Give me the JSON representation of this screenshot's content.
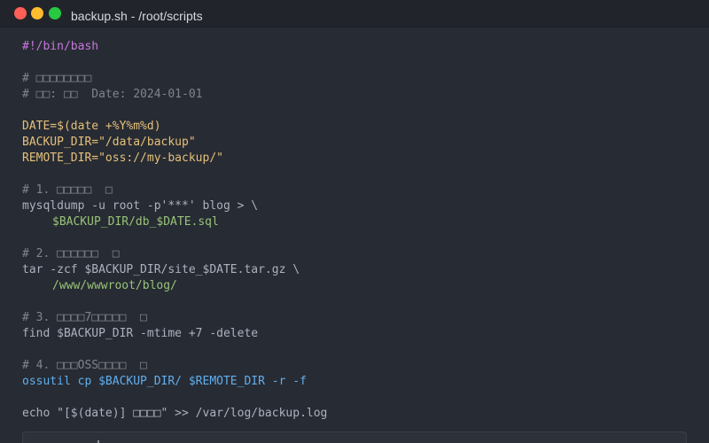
{
  "window": {
    "title": "backup.sh - /root/scripts",
    "controls": {
      "close_color": "#ff5f57",
      "minimize_color": "#febc2e",
      "maximize_color": "#28c840"
    }
  },
  "editor": {
    "lines": [
      "#!/bin/bash",
      "",
      "# □□□□□□□□",
      "# □□: □□  Date: 2024-01-01",
      "",
      "DATE=$(date +%Y%m%d)",
      "BACKUP_DIR=\"/data/backup\"",
      "REMOTE_DIR=\"oss://my-backup/\"",
      "",
      "# 1. □□□□□  □",
      "mysqldump -u root -p'***' blog > \\",
      "$BACKUP_DIR/db_$DATE.sql",
      "",
      "# 2. □□□□□□  □",
      "tar -zcf $BACKUP_DIR/site_$DATE.tar.gz \\",
      "/www/wwwroot/blog/",
      "",
      "# 3. □□□□7□□□□□  □",
      "find $BACKUP_DIR -mtime +7 -delete",
      "",
      "# 4. □□□OSS□□□□  □",
      "ossutil cp $BACKUP_DIR/ $REMOTE_DIR -r -f",
      "",
      "echo \"[$(date)] □□□□\" >> /var/log/backup.log"
    ]
  },
  "colors": {
    "background": "#272b33",
    "shebang": "#c678dd",
    "comment": "#7f848e",
    "variable": "#e5c07b",
    "plain": "#abb2bf",
    "string": "#98c379",
    "command": "#61afef"
  }
}
